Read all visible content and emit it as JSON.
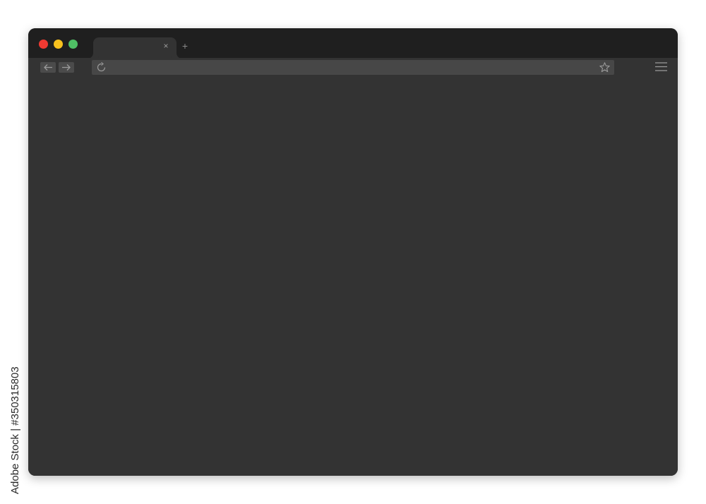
{
  "colors": {
    "page_background": "#ffffff",
    "titlebar": "#1f1f1f",
    "window": "#333333",
    "control": "#4b4b4b",
    "address_bar": "#474747",
    "icon": "#9a9a9a",
    "traffic_close": "#f03a32",
    "traffic_minimize": "#f7c11e",
    "traffic_maximize": "#4fc065"
  },
  "window": {
    "traffic_lights": [
      "close",
      "minimize",
      "maximize"
    ],
    "tab": {
      "title": "",
      "close_glyph": "×"
    },
    "new_tab_glyph": "+"
  },
  "toolbar": {
    "back_icon": "arrow-left-icon",
    "forward_icon": "arrow-right-icon",
    "reload_icon": "reload-icon",
    "bookmark_icon": "star-icon",
    "menu_icon": "hamburger-menu-icon",
    "address": {
      "value": ""
    }
  },
  "watermark": {
    "text": "Adobe Stock",
    "stock_id": "Adobe Stock | #350315803"
  }
}
